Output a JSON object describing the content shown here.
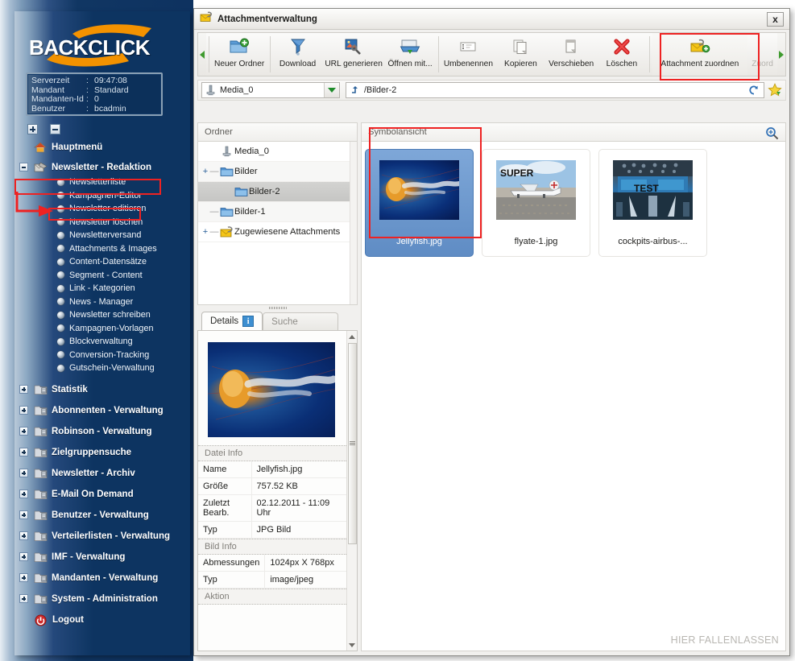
{
  "sidebar": {
    "logo_text": "BACKCLICK",
    "info": [
      {
        "label": "Serverzeit",
        "sep": ":",
        "value": "09:47:08"
      },
      {
        "label": "Mandant",
        "sep": ":",
        "value": "Standard"
      },
      {
        "label": "Mandanten-Id",
        "sep": ":",
        "value": "0"
      },
      {
        "label": "Benutzer",
        "sep": ":",
        "value": "bcadmin"
      }
    ],
    "expand_all_label": "+",
    "collapse_all_label": "-",
    "home": {
      "label": "Hauptmenü",
      "icon": "home-icon"
    },
    "section": {
      "label": "Newsletter - Redaktion",
      "icon": "newsletter-icon",
      "state": "expanded"
    },
    "sub_items": [
      {
        "label": "Newsletterliste"
      },
      {
        "label": "Kampagnen-Editor"
      },
      {
        "label": "Newsletter editieren"
      },
      {
        "label": "Newsletter löschen"
      },
      {
        "label": "Newsletterversand"
      },
      {
        "label": "Attachments & Images"
      },
      {
        "label": "Content-Datensätze"
      },
      {
        "label": "Segment - Content"
      },
      {
        "label": "Link - Kategorien"
      },
      {
        "label": "News - Manager"
      },
      {
        "label": "Newsletter schreiben"
      },
      {
        "label": "Kampagnen-Vorlagen"
      },
      {
        "label": "Blockverwaltung"
      },
      {
        "label": "Conversion-Tracking"
      },
      {
        "label": "Gutschein-Verwaltung"
      }
    ],
    "groups": [
      {
        "label": "Statistik",
        "icon": "folder-icon"
      },
      {
        "label": "Abonnenten - Verwaltung",
        "icon": "folder-icon"
      },
      {
        "label": "Robinson - Verwaltung",
        "icon": "folder-icon"
      },
      {
        "label": "Zielgruppensuche",
        "icon": "folder-icon"
      },
      {
        "label": "Newsletter - Archiv",
        "icon": "folder-icon"
      },
      {
        "label": "E-Mail On Demand",
        "icon": "folder-icon"
      },
      {
        "label": "Benutzer - Verwaltung",
        "icon": "folder-icon"
      },
      {
        "label": "Verteilerlisten - Verwaltung",
        "icon": "folder-icon"
      },
      {
        "label": "IMF - Verwaltung",
        "icon": "folder-icon"
      },
      {
        "label": "Mandanten - Verwaltung",
        "icon": "folder-icon"
      },
      {
        "label": "System - Administration",
        "icon": "folder-icon"
      }
    ],
    "logout": {
      "label": "Logout",
      "icon": "power-icon"
    }
  },
  "window": {
    "title": "Attachmentverwaltung",
    "title_icon": "attachment-mail-icon",
    "close_label": "x"
  },
  "toolbar": {
    "scroll_left_icon": "triangle-left-icon",
    "scroll_right_icon": "triangle-right-icon",
    "buttons": [
      {
        "label": "Neuer Ordner",
        "icon": "new-folder-icon",
        "disabled": false,
        "accel": "O"
      },
      {
        "label": "Download",
        "icon": "download-funnel-icon",
        "disabled": false,
        "accel": "n"
      },
      {
        "label": "URL generieren",
        "icon": "url-generate-icon",
        "disabled": false,
        "accel": ""
      },
      {
        "label": "Öffnen mit...",
        "icon": "open-with-icon",
        "disabled": false,
        "accel": "f"
      },
      {
        "label": "Umbenennen",
        "icon": "rename-icon",
        "disabled": false,
        "accel": "U"
      },
      {
        "label": "Kopieren",
        "icon": "copy-icon",
        "disabled": false,
        "accel": "K"
      },
      {
        "label": "Verschieben",
        "icon": "move-icon",
        "disabled": false,
        "accel": "V"
      },
      {
        "label": "Löschen",
        "icon": "delete-red-x-icon",
        "disabled": false,
        "accel": "L"
      },
      {
        "label": "Attachment zuordnen",
        "icon": "assign-attachment-icon",
        "disabled": false,
        "accel": "",
        "highlighted": true
      },
      {
        "label": "Zuord",
        "icon": "assign-icon",
        "disabled": true,
        "accel": ""
      }
    ]
  },
  "pathbar": {
    "drive_label": "Media_0",
    "drive_icon": "drive-icon",
    "up_icon": "folder-up-icon",
    "path_value": "/Bilder-2",
    "refresh_icon": "refresh-icon",
    "favorite_icon": "favorite-star-icon",
    "dropdown_icon": "caret-down-icon"
  },
  "tree": {
    "header": "Ordner",
    "rows": [
      {
        "label": "Media_0",
        "icon": "drive-icon",
        "expander": "",
        "depth": 0,
        "selected": false
      },
      {
        "label": "Bilder",
        "icon": "folder-blue-icon",
        "expander": "+",
        "depth": 1,
        "selected": false
      },
      {
        "label": "Bilder-2",
        "icon": "folder-blue-icon",
        "expander": "",
        "depth": 2,
        "selected": true
      },
      {
        "label": "Bilder-1",
        "icon": "folder-blue-icon",
        "expander": "",
        "depth": 1,
        "selected": false
      },
      {
        "label": "Zugewiesene Attachments",
        "icon": "attachment-mail-icon",
        "expander": "+",
        "depth": 1,
        "selected": false
      }
    ]
  },
  "details": {
    "tab_active": "Details",
    "tab_inactive": "Suche",
    "info_badge": "i",
    "preview_alt": "Jellyfish preview",
    "sections": [
      {
        "title": "Datei Info",
        "rows": [
          {
            "key": "Name",
            "value": "Jellyfish.jpg"
          },
          {
            "key": "Größe",
            "value": "757.52 KB"
          },
          {
            "key": "Zuletzt Bearb.",
            "value": "02.12.2011 - 11:09 Uhr"
          },
          {
            "key": "Typ",
            "value": "JPG Bild"
          }
        ]
      },
      {
        "title": "Bild Info",
        "rows": [
          {
            "key": "Abmessungen",
            "value": "1024px X 768px"
          },
          {
            "key": "Typ",
            "value": "image/jpeg"
          }
        ]
      },
      {
        "title": "Aktion",
        "rows": []
      }
    ]
  },
  "iconview": {
    "header": "Symbolansicht",
    "magnify_icon": "magnifier-plus-icon",
    "drop_hint": "HIER FALLENLASSEN",
    "items": [
      {
        "label": "Jellyfish.jpg",
        "selected": true,
        "kind": "jelly",
        "caption": ""
      },
      {
        "label": "flyate-1.jpg",
        "selected": false,
        "kind": "plane",
        "caption": "SUPER"
      },
      {
        "label": "cockpits-airbus-...",
        "selected": false,
        "kind": "cockpit",
        "caption": "TEST"
      }
    ]
  },
  "colors": {
    "sidebar_dark": "#0d3461",
    "sidebar_light": "#b9c9d9",
    "brand_orange": "#f5a623",
    "highlight_red": "#ee2222",
    "selection_blue": "#5f8cc4",
    "window_bg": "#f1f0ee"
  }
}
